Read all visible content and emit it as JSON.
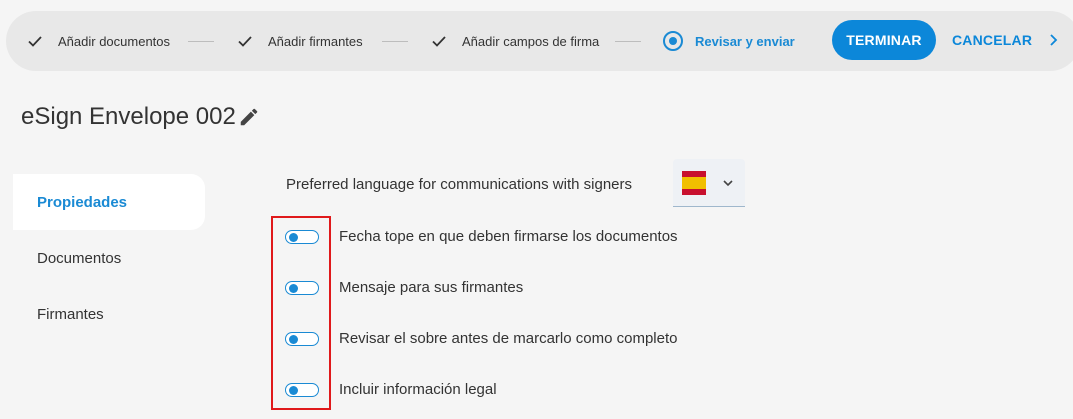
{
  "stepper": {
    "steps": [
      {
        "label": "Añadir documentos",
        "state": "done"
      },
      {
        "label": "Añadir firmantes",
        "state": "done"
      },
      {
        "label": "Añadir campos de firma",
        "state": "done"
      },
      {
        "label": "Revisar y enviar",
        "state": "active"
      }
    ],
    "finish_label": "TERMINAR",
    "cancel_label": "CANCELAR"
  },
  "envelope": {
    "title": "eSign Envelope 002"
  },
  "sidebar": {
    "items": [
      {
        "label": "Propiedades",
        "active": true
      },
      {
        "label": "Documentos",
        "active": false
      },
      {
        "label": "Firmantes",
        "active": false
      }
    ]
  },
  "properties": {
    "language_label": "Preferred language for communications with signers",
    "language_flag_icon": "spain-flag-icon",
    "options": [
      {
        "label": "Fecha tope en que deben firmarse los documentos",
        "enabled": false
      },
      {
        "label": "Mensaje para sus firmantes",
        "enabled": false
      },
      {
        "label": "Revisar el sobre antes de marcarlo como completo",
        "enabled": false
      },
      {
        "label": "Incluir información legal",
        "enabled": false
      }
    ]
  },
  "colors": {
    "accent": "#0c87d9",
    "highlight": "#e0191b"
  }
}
